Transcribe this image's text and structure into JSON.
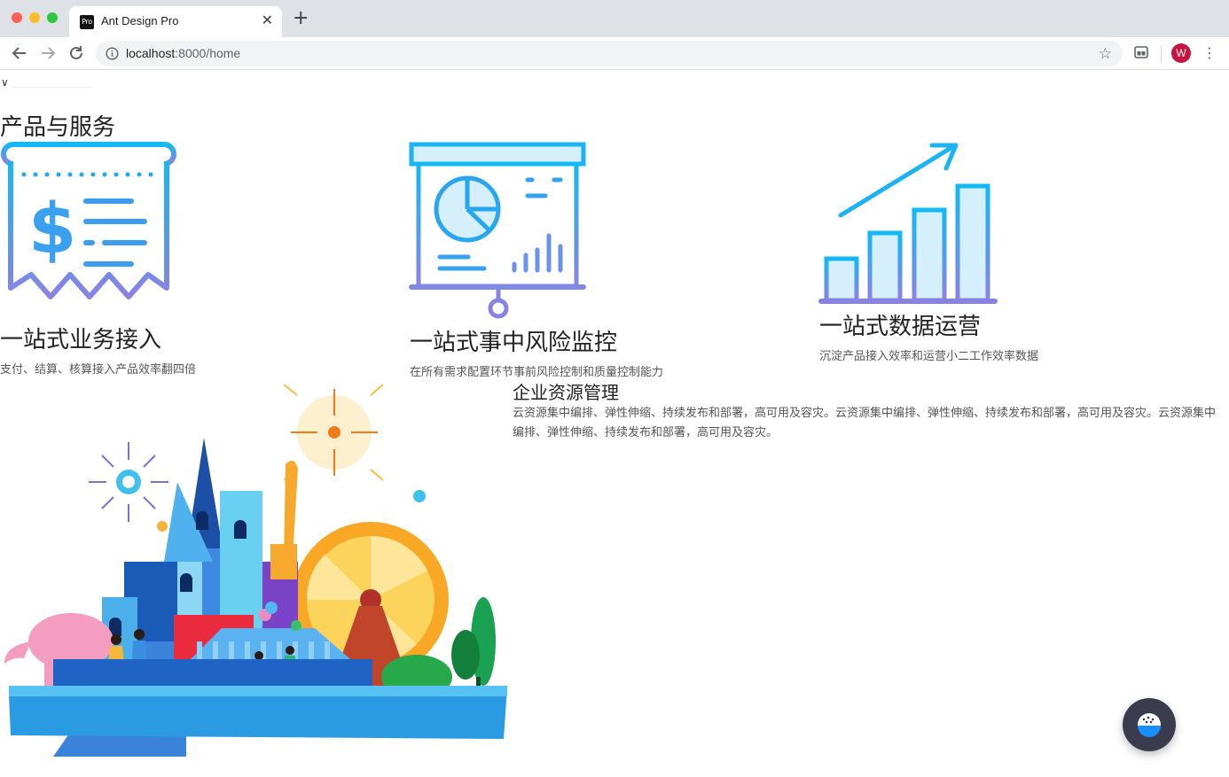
{
  "browser": {
    "tab_title": "Ant Design Pro",
    "favicon_text": "Pro",
    "url_host": "localhost",
    "url_rest": ":8000/home",
    "avatar_letter": "W"
  },
  "page": {
    "collapse_glyph": "∨",
    "section_title": "产品与服务",
    "features": [
      {
        "title": "一站式业务接入",
        "desc": "支付、结算、核算接入产品效率翻四倍",
        "icon": "receipt-icon"
      },
      {
        "title": "一站式事中风险监控",
        "desc": "在所有需求配置环节事前风险控制和质量控制能力",
        "icon": "presentation-chart-icon"
      },
      {
        "title": "一站式数据运营",
        "desc": "沉淀产品接入效率和运营小二工作效率数据",
        "icon": "growth-bar-chart-icon"
      }
    ],
    "erp": {
      "title": "企业资源管理",
      "desc": "云资源集中编排、弹性伸缩、持续发布和部署，高可用及容灾。云资源集中编排、弹性伸缩、持续发布和部署，高可用及容灾。云资源集中编排、弹性伸缩、持续发布和部署，高可用及容灾。"
    }
  },
  "colors": {
    "icon_gradient_top": "#1fb6f5",
    "icon_gradient_bottom": "#8a84e3",
    "float_button_bg": "#3a3c4e"
  }
}
